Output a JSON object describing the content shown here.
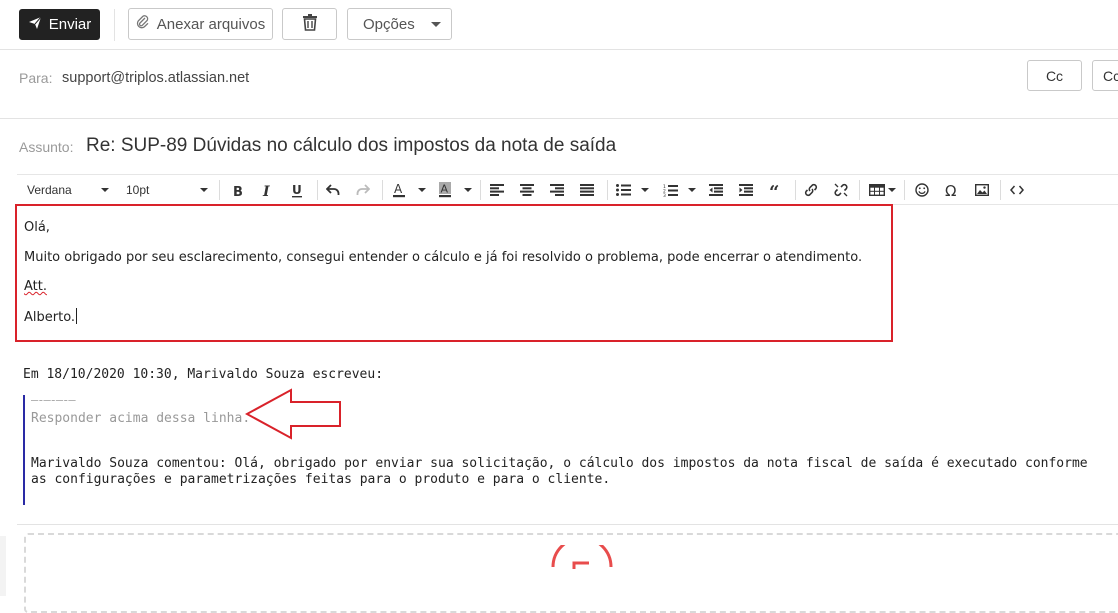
{
  "toolbar": {
    "send_label": "Enviar",
    "attach_label": "Anexar arquivos",
    "options_label": "Opções"
  },
  "to": {
    "label": "Para:",
    "value": "support@triplos.atlassian.net",
    "cc_label": "Cc",
    "cco_label": "Cc"
  },
  "subject": {
    "label": "Assunto:",
    "value": "Re: SUP-89 Dúvidas no cálculo dos impostos da nota de saída"
  },
  "editor_toolbar": {
    "font": "Verdana",
    "size": "10pt"
  },
  "message": {
    "lines": [
      "Olá,",
      "Muito obrigado por seu esclarecimento, consegui entender o cálculo e já foi resolvido o problema, pode encerrar o atendimento.",
      "Att.",
      "Alberto."
    ]
  },
  "quote": {
    "header": "Em 18/10/2020 10:30, Marivaldo Souza escreveu:",
    "separator": "—-—-—-—",
    "reply_above": "Responder acima dessa linha.",
    "comment": "Marivaldo Souza comentou: Olá, obrigado por enviar sua solicitação, o cálculo dos impostos da nota fiscal de saída é executado conforme as configurações e parametrizações feitas para o produto e para o cliente."
  },
  "colors": {
    "highlight_red": "#d9222a",
    "quote_bar": "#2a2aa5",
    "send_button_bg": "#222222"
  }
}
